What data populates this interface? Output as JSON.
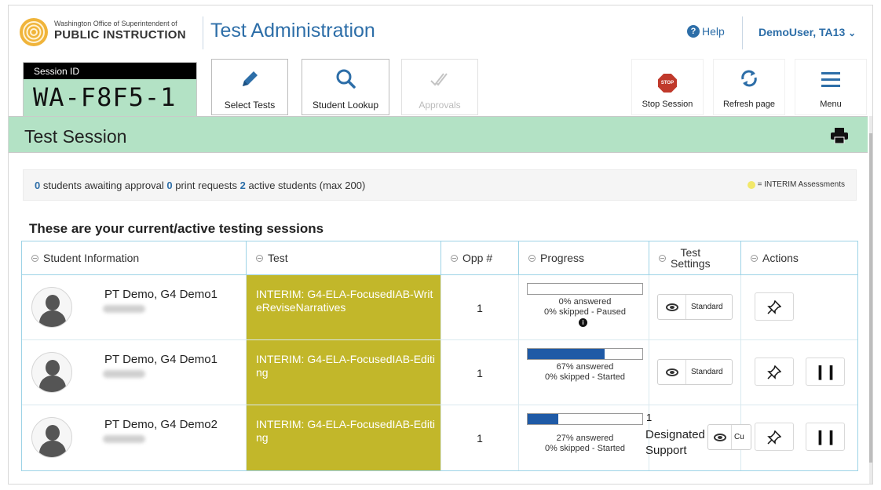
{
  "header": {
    "org_small": "Washington Office of Superintendent of",
    "org_big": "PUBLIC INSTRUCTION",
    "app_title": "Test Administration",
    "help_label": "Help",
    "user_label": "DemoUser, TA13"
  },
  "session": {
    "label": "Session ID",
    "id": "WA-F8F5-1"
  },
  "toolbar": {
    "select_tests": "Select Tests",
    "student_lookup": "Student Lookup",
    "approvals": "Approvals",
    "stop_session": "Stop Session",
    "stop_icon_text": "STOP",
    "refresh_page": "Refresh page",
    "menu": "Menu"
  },
  "greenbar": {
    "title": "Test Session"
  },
  "stats": {
    "awaiting_count": "0",
    "awaiting_text": " students awaiting approval ",
    "print_count": "0",
    "print_text": " print requests ",
    "active_count": "2",
    "active_text": " active students (max 200)",
    "legend_text": "= INTERIM Assessments"
  },
  "section_title": "These are your current/active testing sessions",
  "table": {
    "headers": {
      "student": "Student Information",
      "test": "Test",
      "opp": "Opp #",
      "progress": "Progress",
      "settings_line1": "Test",
      "settings_line2": "Settings",
      "actions": "Actions"
    },
    "rows": [
      {
        "student": "PT Demo, G4 Demo1",
        "test": "INTERIM: G4-ELA-FocusedIAB-WriteReviseNarratives",
        "opp": "1",
        "progress_fraction": 0.0,
        "answered": "0% answered",
        "skipped": "0% skipped  -  Paused",
        "setting": "Standard"
      },
      {
        "student": "PT Demo, G4 Demo1",
        "test": "INTERIM: G4-ELA-FocusedIAB-Editing",
        "opp": "1",
        "progress_fraction": 0.67,
        "answered": "67% answered",
        "skipped": "0% skipped  -  Started",
        "setting": "Standard"
      },
      {
        "student": "PT Demo, G4 Demo2",
        "test": "INTERIM: G4-ELA-FocusedIAB-Editing",
        "opp": "1",
        "progress_fraction": 0.27,
        "answered": "27% answered",
        "skipped": "0% skipped  -  Started",
        "progress_suffix": "1",
        "designated_line1": "Designated",
        "designated_line2": "Support",
        "setting": "Cu"
      }
    ]
  },
  "colors": {
    "accent_blue": "#2d6ea8",
    "session_green": "#b3e2c5",
    "interim_yellow": "#c2b72a",
    "progress_blue": "#1f5aa6"
  },
  "icons": {
    "logo": "ospi-logo",
    "help": "help-circle-icon",
    "user_menu": "chevron-down-icon",
    "select_tests": "pencil-icon",
    "student_lookup": "search-icon",
    "approvals": "double-check-icon",
    "stop_session": "stop-sign-icon",
    "refresh": "refresh-icon",
    "menu": "hamburger-icon",
    "print": "printer-icon",
    "avatar": "user-silhouette-icon",
    "info": "info-icon",
    "view_settings": "eye-icon",
    "pin": "pin-icon",
    "pause": "pause-icon"
  }
}
